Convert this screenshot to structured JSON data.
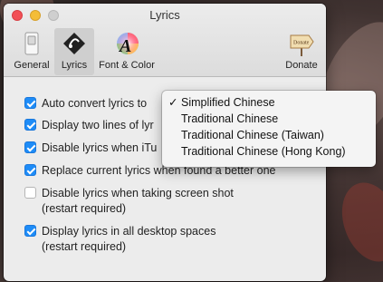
{
  "window": {
    "title": "Lyrics"
  },
  "toolbar": {
    "items": [
      {
        "label": "General",
        "icon": "switch-icon"
      },
      {
        "label": "Lyrics",
        "icon": "lyrics-icon"
      },
      {
        "label": "Font & Color",
        "icon": "font-color-icon"
      },
      {
        "label": "Donate",
        "icon": "donate-icon"
      }
    ],
    "selected": "Lyrics",
    "donate_sign_text": "Donate"
  },
  "options": [
    {
      "label": "Auto convert lyrics to",
      "checked": true
    },
    {
      "label": "Display two lines of lyr",
      "checked": true
    },
    {
      "label": "Disable lyrics when iTu",
      "checked": true
    },
    {
      "label": "Replace current lyrics when found a better one",
      "checked": true
    },
    {
      "label": "Disable lyrics when taking screen shot",
      "sub": "(restart required)",
      "checked": false
    },
    {
      "label": "Display lyrics in all desktop spaces",
      "sub": "(restart required)",
      "checked": true
    }
  ],
  "conversion_menu": {
    "checkmark": "✓",
    "selected": "Simplified Chinese",
    "options": [
      "Simplified Chinese",
      "Traditional Chinese",
      "Traditional Chinese (Taiwan)",
      "Traditional Chinese (Hong Kong)"
    ]
  },
  "colors": {
    "accent": "#1e8cf7",
    "close": "#f25056",
    "minimize": "#f4bd37"
  }
}
